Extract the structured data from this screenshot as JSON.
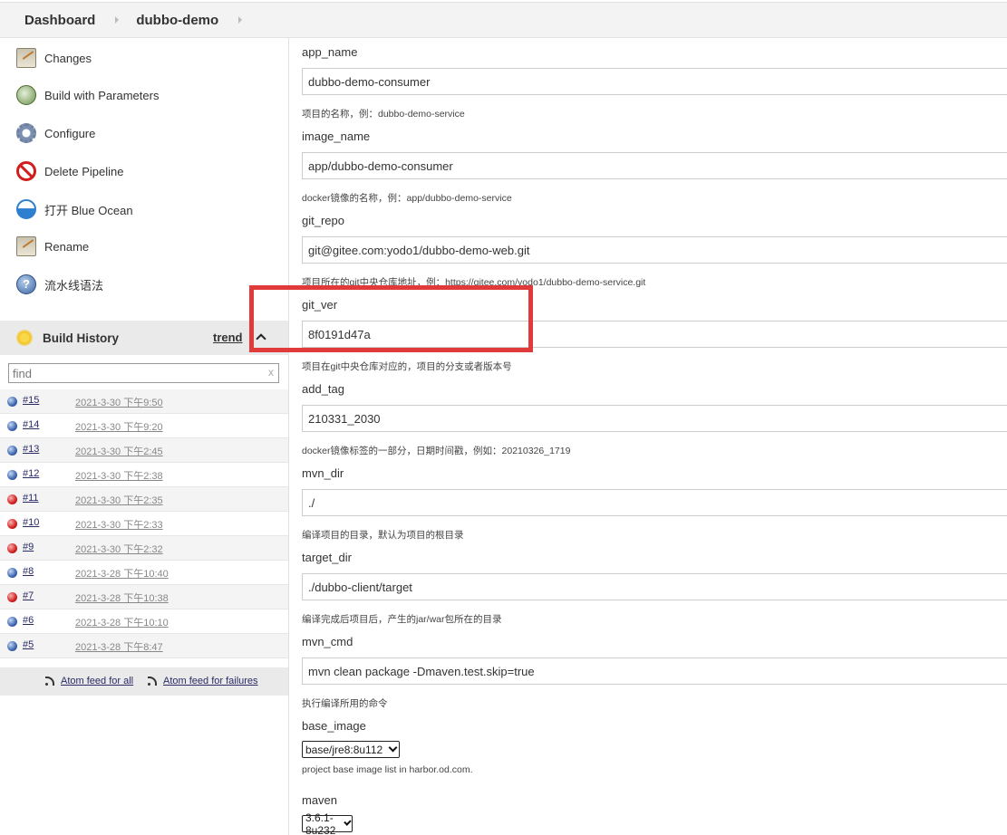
{
  "breadcrumb": {
    "items": [
      "Dashboard",
      "dubbo-demo"
    ]
  },
  "sidebar": {
    "tasks": [
      {
        "label": "Changes",
        "icon": "notepad-icon"
      },
      {
        "label": "Build with Parameters",
        "icon": "clock-icon"
      },
      {
        "label": "Configure",
        "icon": "gear-icon"
      },
      {
        "label": "Delete Pipeline",
        "icon": "delete-icon"
      },
      {
        "label": "打开 Blue Ocean",
        "icon": "blue-ocean-icon"
      },
      {
        "label": "Rename",
        "icon": "notepad-icon"
      },
      {
        "label": "流水线语法",
        "icon": "help-icon"
      }
    ]
  },
  "build_history": {
    "title": "Build History",
    "trend_label": "trend",
    "search_placeholder": "find",
    "clear_label": "x",
    "builds": [
      {
        "number": "#15",
        "date": "2021-3-30 下午9:50",
        "status": "blue"
      },
      {
        "number": "#14",
        "date": "2021-3-30 下午9:20",
        "status": "blue"
      },
      {
        "number": "#13",
        "date": "2021-3-30 下午2:45",
        "status": "blue"
      },
      {
        "number": "#12",
        "date": "2021-3-30 下午2:38",
        "status": "blue"
      },
      {
        "number": "#11",
        "date": "2021-3-30 下午2:35",
        "status": "red"
      },
      {
        "number": "#10",
        "date": "2021-3-30 下午2:33",
        "status": "red"
      },
      {
        "number": "#9",
        "date": "2021-3-30 下午2:32",
        "status": "red"
      },
      {
        "number": "#8",
        "date": "2021-3-28 下午10:40",
        "status": "blue"
      },
      {
        "number": "#7",
        "date": "2021-3-28 下午10:38",
        "status": "red"
      },
      {
        "number": "#6",
        "date": "2021-3-28 下午10:10",
        "status": "blue"
      },
      {
        "number": "#5",
        "date": "2021-3-28 下午8:47",
        "status": "blue"
      }
    ],
    "feed_all": "Atom feed for all",
    "feed_failures": "Atom feed for failures"
  },
  "params": [
    {
      "name": "app_name",
      "value": "dubbo-demo-consumer",
      "description": "项目的名称，例：dubbo-demo-service"
    },
    {
      "name": "image_name",
      "value": "app/dubbo-demo-consumer",
      "description": "docker镜像的名称，例：app/dubbo-demo-service"
    },
    {
      "name": "git_repo",
      "value": "git@gitee.com:yodo1/dubbo-demo-web.git",
      "description": "项目所在的git中央仓库地址，例：https://gitee.com/yodo1/dubbo-demo-service.git"
    },
    {
      "name": "git_ver",
      "value": "8f0191d47a",
      "description": "项目在git中央仓库对应的，项目的分支或者版本号"
    },
    {
      "name": "add_tag",
      "value": "210331_2030",
      "description": "docker镜像标签的一部分，日期时间戳，例如：20210326_1719"
    },
    {
      "name": "mvn_dir",
      "value": "./",
      "description": "编译项目的目录，默认为项目的根目录"
    },
    {
      "name": "target_dir",
      "value": "./dubbo-client/target",
      "description": "编译完成后项目后，产生的jar/war包所在的目录"
    },
    {
      "name": "mvn_cmd",
      "value": "mvn clean package -Dmaven.test.skip=true",
      "description": "执行编译所用的命令"
    }
  ],
  "selects": [
    {
      "name": "base_image",
      "value": "base/jre8:8u112",
      "description": "project base image list in harbor.od.com."
    },
    {
      "name": "maven",
      "value": "3.6.1-8u232",
      "description": ""
    }
  ],
  "colors": {
    "highlight": "#e03a3a",
    "success": "#3c66b0",
    "failure": "#d42020"
  }
}
